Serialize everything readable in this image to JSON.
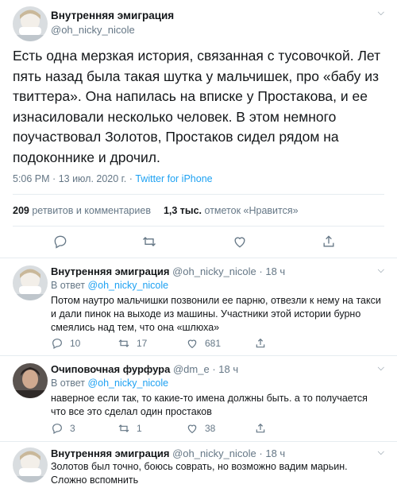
{
  "main_tweet": {
    "author_name": "Внутренняя эмиграция",
    "author_handle": "@oh_nicky_nicole",
    "text": "Есть одна мерзкая история, связанная с тусовочкой. Лет пять назад была такая шутка у мальчишек, про «бабу из твиттера». Она напилась на вписке у Простакова, и ее изнасиловали несколько человек. В этом немного поучаствовал Золотов, Простаков сидел рядом на подоконнике и дрочил.",
    "time": "5:06 PM",
    "date": "13 июл. 2020 г.",
    "separator": "·",
    "source": "Twitter for iPhone",
    "retweets_count": "209",
    "retweets_label": "ретвитов и комментариев",
    "likes_count": "1,3 тыс.",
    "likes_label": "отметок «Нравится»"
  },
  "replies": [
    {
      "author_name": "Внутренняя эмиграция",
      "author_handle": "@oh_nicky_nicole",
      "age": "18 ч",
      "reply_prefix": "В ответ",
      "reply_to": "@oh_nicky_nicole",
      "text": "Потом наутро мальчишки позвонили ее парню, отвезли к нему на такси и дали пинок на выходе из машины. Участники этой истории бурно смеялись над тем, что она «шлюха»",
      "replies": "10",
      "retweets": "17",
      "likes": "681"
    },
    {
      "author_name": "Очиповочная фурфура",
      "author_handle": "@dm_e",
      "age": "18 ч",
      "reply_prefix": "В ответ",
      "reply_to": "@oh_nicky_nicole",
      "text": "наверное если так, то какие-то имена должны быть. а то получается что все это сделал один простаков",
      "replies": "3",
      "retweets": "1",
      "likes": "38"
    },
    {
      "author_name": "Внутренняя эмиграция",
      "author_handle": "@oh_nicky_nicole",
      "age": "18 ч",
      "text": "Золотов был точно, боюсь соврать, но возможно вадим марьин. Сложно вспомнить"
    }
  ],
  "colors": {
    "text": "#14171a",
    "muted": "#657786",
    "link": "#1da1f2",
    "divider": "#e6ecf0"
  }
}
